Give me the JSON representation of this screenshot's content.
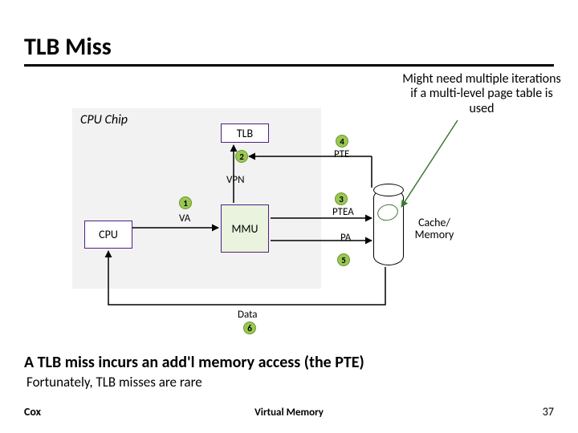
{
  "title": "TLB Miss",
  "note": "Might need multiple iterations if a multi-level page table is used",
  "chip_label": "CPU Chip",
  "boxes": {
    "tlb": "TLB",
    "mmu": "MMU",
    "cpu": "CPU",
    "cache": "Cache/\nMemory"
  },
  "labels": {
    "vpn": "VPN",
    "va": "VA",
    "pte": "PTE",
    "ptea": "PTEA",
    "pa": "PA",
    "data": "Data"
  },
  "steps": {
    "s1": "1",
    "s2": "2",
    "s3": "3",
    "s4": "4",
    "s5": "5",
    "s6": "6"
  },
  "body_text": "A TLB miss incurs an add'l memory access (the PTE)",
  "body_sub": "Fortunately, TLB misses are rare",
  "footer": {
    "left": "Cox",
    "center": "Virtual Memory",
    "right": "37"
  }
}
